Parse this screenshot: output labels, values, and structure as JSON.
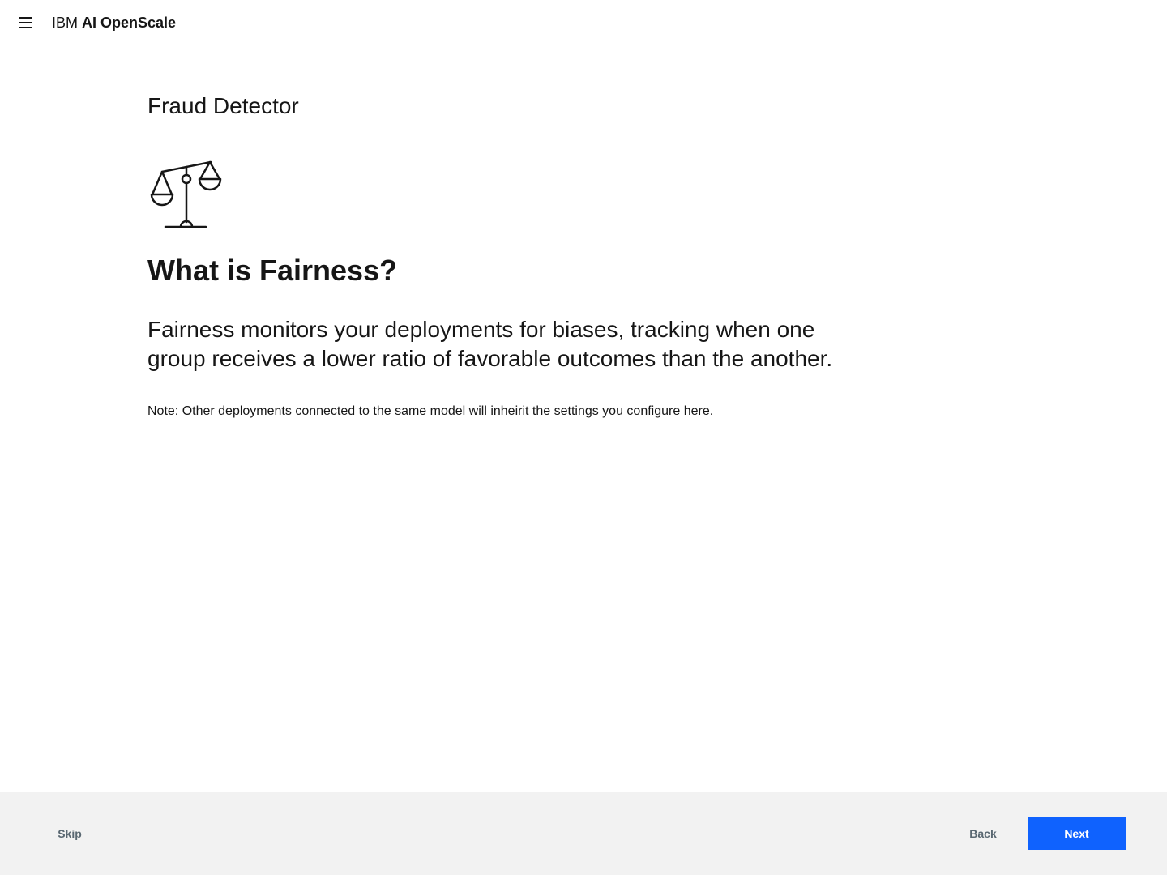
{
  "header": {
    "menu_icon": "hamburger-menu-icon",
    "brand_prefix": "IBM",
    "brand_name": "AI OpenScale"
  },
  "main": {
    "model_name": "Fraud Detector",
    "illustration_icon": "balance-scale-icon",
    "title": "What is Fairness?",
    "description": "Fairness monitors your deployments for biases, tracking when one group receives a lower ratio of favorable outcomes than the another.",
    "note": "Note: Other deployments connected to the same model will inheirit the settings you configure here."
  },
  "footer": {
    "skip_label": "Skip",
    "back_label": "Back",
    "next_label": "Next"
  },
  "colors": {
    "primary_button": "#0f62fe",
    "footer_background": "#f2f2f2",
    "secondary_text": "#5a6872",
    "text": "#161616"
  }
}
